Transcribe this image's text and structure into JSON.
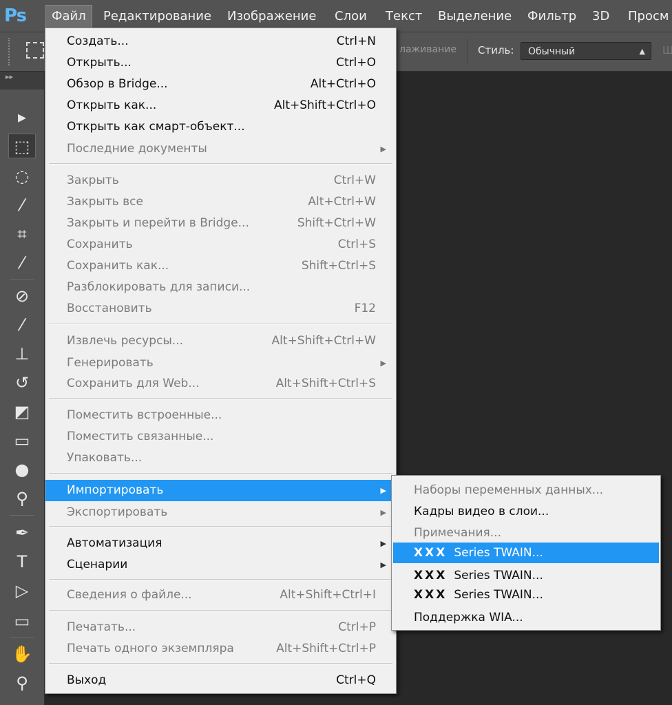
{
  "app": {
    "logo": "Ps"
  },
  "menubar": {
    "items": [
      "Файл",
      "Редактирование",
      "Изображение",
      "Слои",
      "Текст",
      "Выделение",
      "Фильтр",
      "3D",
      "Просм"
    ]
  },
  "options": {
    "smoothing": "лаживание",
    "style_label": "Стиль:",
    "style_value": "Обычный",
    "width_label": "Ш"
  },
  "tools_panel": {
    "collapse": "▸▸",
    "icons": [
      "move-icon",
      "rect-marquee-icon",
      "lasso-icon",
      "quick-select-icon",
      "crop-icon",
      "eyedropper-icon",
      "healing-brush-icon",
      "brush-icon",
      "clone-stamp-icon",
      "history-brush-icon",
      "eraser-icon",
      "gradient-icon",
      "blur-icon",
      "dodge-icon",
      "pen-icon",
      "type-icon",
      "path-select-icon",
      "rectangle-icon",
      "hand-icon",
      "zoom-icon"
    ]
  },
  "file_menu": {
    "create": {
      "label": "Создать...",
      "shortcut": "Ctrl+N"
    },
    "open": {
      "label": "Открыть...",
      "shortcut": "Ctrl+O"
    },
    "bridge": {
      "label": "Обзор в Bridge...",
      "shortcut": "Alt+Ctrl+O"
    },
    "open_as": {
      "label": "Открыть как...",
      "shortcut": "Alt+Shift+Ctrl+O"
    },
    "open_smart": {
      "label": "Открыть как смарт-объект..."
    },
    "recent": {
      "label": "Последние документы"
    },
    "close": {
      "label": "Закрыть",
      "shortcut": "Ctrl+W"
    },
    "close_all": {
      "label": "Закрыть все",
      "shortcut": "Alt+Ctrl+W"
    },
    "close_bridge": {
      "label": "Закрыть и перейти в Bridge...",
      "shortcut": "Shift+Ctrl+W"
    },
    "save": {
      "label": "Сохранить",
      "shortcut": "Ctrl+S"
    },
    "save_as": {
      "label": "Сохранить как...",
      "shortcut": "Shift+Ctrl+S"
    },
    "unlock": {
      "label": "Разблокировать для записи..."
    },
    "revert": {
      "label": "Восстановить",
      "shortcut": "F12"
    },
    "extract": {
      "label": "Извлечь ресурсы...",
      "shortcut": "Alt+Shift+Ctrl+W"
    },
    "generate": {
      "label": "Генерировать"
    },
    "save_web": {
      "label": "Сохранить для Web...",
      "shortcut": "Alt+Shift+Ctrl+S"
    },
    "place_embedded": {
      "label": "Поместить встроенные..."
    },
    "place_linked": {
      "label": "Поместить связанные..."
    },
    "package": {
      "label": "Упаковать..."
    },
    "import": {
      "label": "Импортировать"
    },
    "export": {
      "label": "Экспортировать"
    },
    "automate": {
      "label": "Автоматизация"
    },
    "scripts": {
      "label": "Сценарии"
    },
    "file_info": {
      "label": "Сведения о файле...",
      "shortcut": "Alt+Shift+Ctrl+I"
    },
    "print": {
      "label": "Печатать...",
      "shortcut": "Ctrl+P"
    },
    "print_one": {
      "label": "Печать одного экземпляра",
      "shortcut": "Alt+Shift+Ctrl+P"
    },
    "exit": {
      "label": "Выход",
      "shortcut": "Ctrl+Q"
    }
  },
  "import_submenu": {
    "variables": "Наборы переменных данных...",
    "video_frames": "Кадры видео в слои...",
    "notes": "Примечания...",
    "twain_1_prefix": "XXX",
    "twain_1": "Series TWAIN...",
    "twain_2_prefix": "XXX",
    "twain_2": "Series TWAIN...",
    "twain_3_prefix": "XXX",
    "twain_3": "Series TWAIN...",
    "wia": "Поддержка WIA..."
  },
  "colors": {
    "highlight": "#2196f3",
    "menu_bg": "#f0f0f0",
    "workspace": "#282828",
    "chrome": "#535353"
  }
}
